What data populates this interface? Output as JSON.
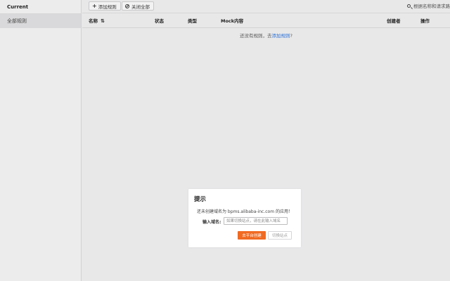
{
  "sidebar": {
    "header": "Current",
    "items": [
      {
        "label": "全部规则"
      }
    ]
  },
  "toolbar": {
    "add_rule_label": "添加规则",
    "close_all_label": "关闭全部",
    "search_placeholder": "根据名称和请求路"
  },
  "table": {
    "columns": [
      "名称",
      "状态",
      "类型",
      "Mock内容",
      "创建者",
      "操作"
    ],
    "sort_icon": "⇅",
    "empty_prefix": "还没有规则，去",
    "empty_link": "添加规则",
    "empty_suffix": "?"
  },
  "dialog": {
    "title": "提示",
    "message": "还未创建域名为 bpms.alibaba-inc.com 的应用！",
    "domain_label": "输入域名:",
    "domain_placeholder": "如果切换站点，请在此输入域名",
    "create_button": "去平台创建",
    "switch_button": "切换站点"
  },
  "colors": {
    "primary": "#f06a22",
    "link": "#2a6fd6",
    "background": "#e8e8e9"
  }
}
